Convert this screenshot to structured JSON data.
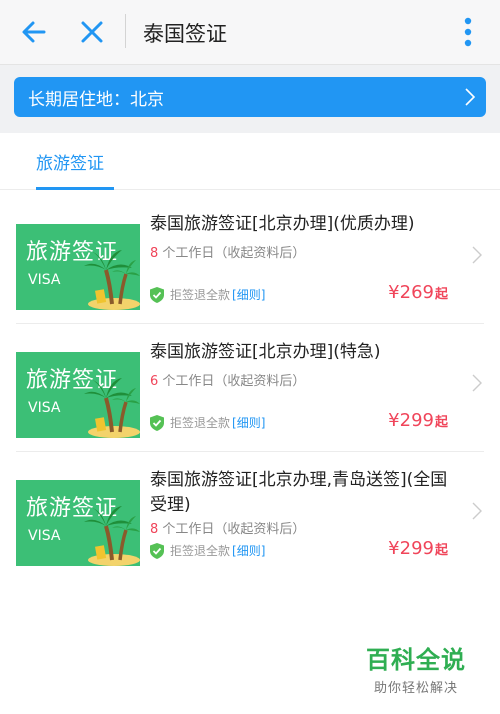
{
  "header": {
    "title": "泰国签证"
  },
  "residence": {
    "label": "长期居住地：北京"
  },
  "tabs": [
    {
      "label": "旅游签证"
    }
  ],
  "colors": {
    "accent": "#2196f3",
    "price": "#f0455a",
    "thumb": "#3cbf76",
    "shield": "#55c155"
  },
  "products": [
    {
      "thumb_title": "旅游签证",
      "thumb_sub": "VISA",
      "title": "泰国旅游签证[北京办理](优质办理)",
      "days_num": "8",
      "days_text": " 个工作日（收起资料后）",
      "refund": "拒签退全款",
      "detail": "[细则]",
      "price": "¥269",
      "price_suffix": "起"
    },
    {
      "thumb_title": "旅游签证",
      "thumb_sub": "VISA",
      "title": "泰国旅游签证[北京办理](特急)",
      "days_num": "6",
      "days_text": " 个工作日（收起资料后）",
      "refund": "拒签退全款",
      "detail": "[细则]",
      "price": "¥299",
      "price_suffix": "起"
    },
    {
      "thumb_title": "旅游签证",
      "thumb_sub": "VISA",
      "title": "泰国旅游签证[北京办理,青岛送签](全国受理)",
      "days_num": "8",
      "days_text": " 个工作日（收起资料后）",
      "refund": "拒签退全款",
      "detail": "[细则]",
      "price": "¥299",
      "price_suffix": "起"
    }
  ],
  "watermark": {
    "title": "百科全说",
    "subtitle": "助你轻松解决"
  }
}
